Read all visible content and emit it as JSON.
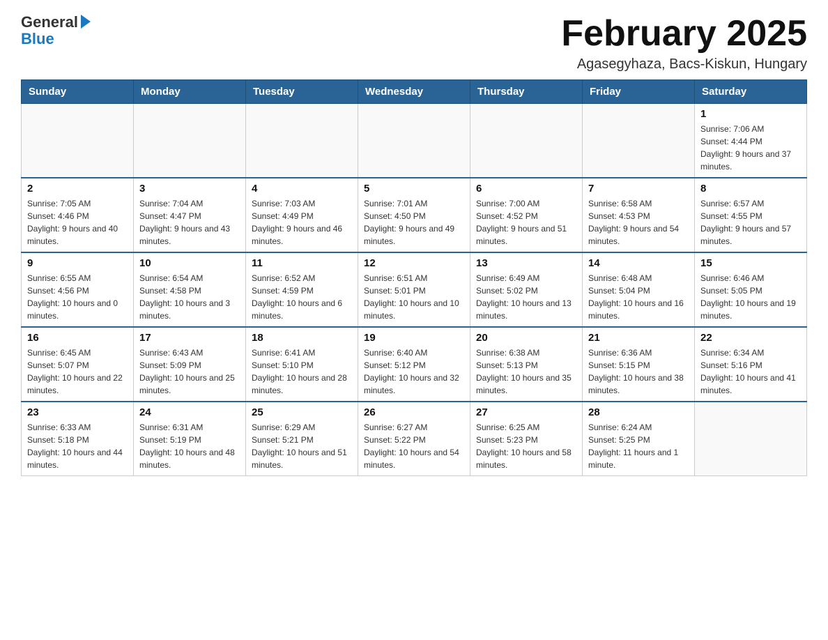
{
  "logo": {
    "general": "General",
    "blue": "Blue"
  },
  "title": "February 2025",
  "location": "Agasegyhaza, Bacs-Kiskun, Hungary",
  "days_of_week": [
    "Sunday",
    "Monday",
    "Tuesday",
    "Wednesday",
    "Thursday",
    "Friday",
    "Saturday"
  ],
  "weeks": [
    [
      {
        "day": "",
        "sunrise": "",
        "sunset": "",
        "daylight": ""
      },
      {
        "day": "",
        "sunrise": "",
        "sunset": "",
        "daylight": ""
      },
      {
        "day": "",
        "sunrise": "",
        "sunset": "",
        "daylight": ""
      },
      {
        "day": "",
        "sunrise": "",
        "sunset": "",
        "daylight": ""
      },
      {
        "day": "",
        "sunrise": "",
        "sunset": "",
        "daylight": ""
      },
      {
        "day": "",
        "sunrise": "",
        "sunset": "",
        "daylight": ""
      },
      {
        "day": "1",
        "sunrise": "Sunrise: 7:06 AM",
        "sunset": "Sunset: 4:44 PM",
        "daylight": "Daylight: 9 hours and 37 minutes."
      }
    ],
    [
      {
        "day": "2",
        "sunrise": "Sunrise: 7:05 AM",
        "sunset": "Sunset: 4:46 PM",
        "daylight": "Daylight: 9 hours and 40 minutes."
      },
      {
        "day": "3",
        "sunrise": "Sunrise: 7:04 AM",
        "sunset": "Sunset: 4:47 PM",
        "daylight": "Daylight: 9 hours and 43 minutes."
      },
      {
        "day": "4",
        "sunrise": "Sunrise: 7:03 AM",
        "sunset": "Sunset: 4:49 PM",
        "daylight": "Daylight: 9 hours and 46 minutes."
      },
      {
        "day": "5",
        "sunrise": "Sunrise: 7:01 AM",
        "sunset": "Sunset: 4:50 PM",
        "daylight": "Daylight: 9 hours and 49 minutes."
      },
      {
        "day": "6",
        "sunrise": "Sunrise: 7:00 AM",
        "sunset": "Sunset: 4:52 PM",
        "daylight": "Daylight: 9 hours and 51 minutes."
      },
      {
        "day": "7",
        "sunrise": "Sunrise: 6:58 AM",
        "sunset": "Sunset: 4:53 PM",
        "daylight": "Daylight: 9 hours and 54 minutes."
      },
      {
        "day": "8",
        "sunrise": "Sunrise: 6:57 AM",
        "sunset": "Sunset: 4:55 PM",
        "daylight": "Daylight: 9 hours and 57 minutes."
      }
    ],
    [
      {
        "day": "9",
        "sunrise": "Sunrise: 6:55 AM",
        "sunset": "Sunset: 4:56 PM",
        "daylight": "Daylight: 10 hours and 0 minutes."
      },
      {
        "day": "10",
        "sunrise": "Sunrise: 6:54 AM",
        "sunset": "Sunset: 4:58 PM",
        "daylight": "Daylight: 10 hours and 3 minutes."
      },
      {
        "day": "11",
        "sunrise": "Sunrise: 6:52 AM",
        "sunset": "Sunset: 4:59 PM",
        "daylight": "Daylight: 10 hours and 6 minutes."
      },
      {
        "day": "12",
        "sunrise": "Sunrise: 6:51 AM",
        "sunset": "Sunset: 5:01 PM",
        "daylight": "Daylight: 10 hours and 10 minutes."
      },
      {
        "day": "13",
        "sunrise": "Sunrise: 6:49 AM",
        "sunset": "Sunset: 5:02 PM",
        "daylight": "Daylight: 10 hours and 13 minutes."
      },
      {
        "day": "14",
        "sunrise": "Sunrise: 6:48 AM",
        "sunset": "Sunset: 5:04 PM",
        "daylight": "Daylight: 10 hours and 16 minutes."
      },
      {
        "day": "15",
        "sunrise": "Sunrise: 6:46 AM",
        "sunset": "Sunset: 5:05 PM",
        "daylight": "Daylight: 10 hours and 19 minutes."
      }
    ],
    [
      {
        "day": "16",
        "sunrise": "Sunrise: 6:45 AM",
        "sunset": "Sunset: 5:07 PM",
        "daylight": "Daylight: 10 hours and 22 minutes."
      },
      {
        "day": "17",
        "sunrise": "Sunrise: 6:43 AM",
        "sunset": "Sunset: 5:09 PM",
        "daylight": "Daylight: 10 hours and 25 minutes."
      },
      {
        "day": "18",
        "sunrise": "Sunrise: 6:41 AM",
        "sunset": "Sunset: 5:10 PM",
        "daylight": "Daylight: 10 hours and 28 minutes."
      },
      {
        "day": "19",
        "sunrise": "Sunrise: 6:40 AM",
        "sunset": "Sunset: 5:12 PM",
        "daylight": "Daylight: 10 hours and 32 minutes."
      },
      {
        "day": "20",
        "sunrise": "Sunrise: 6:38 AM",
        "sunset": "Sunset: 5:13 PM",
        "daylight": "Daylight: 10 hours and 35 minutes."
      },
      {
        "day": "21",
        "sunrise": "Sunrise: 6:36 AM",
        "sunset": "Sunset: 5:15 PM",
        "daylight": "Daylight: 10 hours and 38 minutes."
      },
      {
        "day": "22",
        "sunrise": "Sunrise: 6:34 AM",
        "sunset": "Sunset: 5:16 PM",
        "daylight": "Daylight: 10 hours and 41 minutes."
      }
    ],
    [
      {
        "day": "23",
        "sunrise": "Sunrise: 6:33 AM",
        "sunset": "Sunset: 5:18 PM",
        "daylight": "Daylight: 10 hours and 44 minutes."
      },
      {
        "day": "24",
        "sunrise": "Sunrise: 6:31 AM",
        "sunset": "Sunset: 5:19 PM",
        "daylight": "Daylight: 10 hours and 48 minutes."
      },
      {
        "day": "25",
        "sunrise": "Sunrise: 6:29 AM",
        "sunset": "Sunset: 5:21 PM",
        "daylight": "Daylight: 10 hours and 51 minutes."
      },
      {
        "day": "26",
        "sunrise": "Sunrise: 6:27 AM",
        "sunset": "Sunset: 5:22 PM",
        "daylight": "Daylight: 10 hours and 54 minutes."
      },
      {
        "day": "27",
        "sunrise": "Sunrise: 6:25 AM",
        "sunset": "Sunset: 5:23 PM",
        "daylight": "Daylight: 10 hours and 58 minutes."
      },
      {
        "day": "28",
        "sunrise": "Sunrise: 6:24 AM",
        "sunset": "Sunset: 5:25 PM",
        "daylight": "Daylight: 11 hours and 1 minute."
      },
      {
        "day": "",
        "sunrise": "",
        "sunset": "",
        "daylight": ""
      }
    ]
  ]
}
